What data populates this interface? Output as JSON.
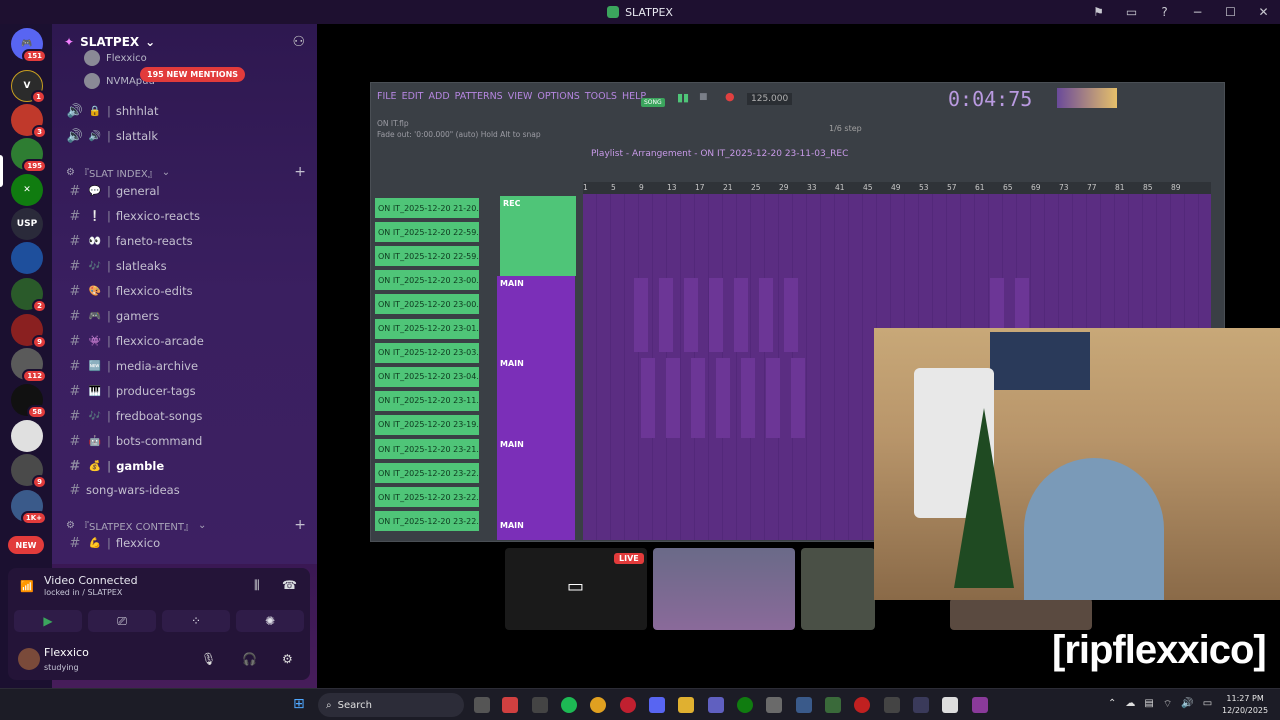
{
  "window": {
    "title": "SLATPEX",
    "controls": [
      "▭",
      "−",
      "☐",
      "✕"
    ]
  },
  "servers": [
    {
      "name": "discord-home",
      "color": "#5865f2",
      "badge": "151"
    },
    {
      "name": "server-v",
      "color": "#2b2b2b",
      "badge": "1"
    },
    {
      "name": "server-3",
      "color": "#c0392b",
      "badge": "3"
    },
    {
      "name": "server-green",
      "color": "#2e7d32",
      "badge": "195"
    },
    {
      "name": "server-xbox",
      "color": "#107c10",
      "badge": ""
    },
    {
      "name": "server-usp",
      "color": "#2a2a3a",
      "badge": ""
    },
    {
      "name": "server-blue",
      "color": "#1e4f9c",
      "badge": ""
    },
    {
      "name": "server-2",
      "color": "#2a5a2a",
      "badge": "2"
    },
    {
      "name": "server-9",
      "color": "#8a2020",
      "badge": "9"
    },
    {
      "name": "server-112",
      "color": "#5a5a5a",
      "badge": "112"
    },
    {
      "name": "server-58",
      "color": "#111111",
      "badge": "58"
    },
    {
      "name": "server-ninja",
      "color": "#e0e0e0",
      "badge": ""
    },
    {
      "name": "server-9b",
      "color": "#4a4a4a",
      "badge": "9"
    },
    {
      "name": "server-1k",
      "color": "#3a5a8a",
      "badge": "1K+"
    },
    {
      "name": "server-new",
      "color": "#222",
      "badge": "NEW"
    }
  ],
  "server_name": "SLATPEX",
  "usp_label": "USP",
  "voice_users": [
    "Flexxico",
    "NVMApuu"
  ],
  "mentions_badge": "195 NEW MENTIONS",
  "voice_channels": [
    {
      "emoji": "🔒",
      "name": "shhhlat"
    },
    {
      "emoji": "🔊",
      "name": "slattalk"
    }
  ],
  "category_index": "『SLAT INDEX』",
  "channels": [
    {
      "emoji": "💬",
      "name": "general",
      "bold": false
    },
    {
      "emoji": "❕",
      "name": "flexxico-reacts",
      "bold": false
    },
    {
      "emoji": "👀",
      "name": "faneto-reacts",
      "bold": false
    },
    {
      "emoji": "🎶",
      "name": "slatleaks",
      "bold": false
    },
    {
      "emoji": "🎨",
      "name": "flexxico-edits",
      "bold": false
    },
    {
      "emoji": "🎮",
      "name": "gamers",
      "bold": false
    },
    {
      "emoji": "👾",
      "name": "flexxico-arcade",
      "bold": false
    },
    {
      "emoji": "🆕",
      "name": "media-archive",
      "bold": false
    },
    {
      "emoji": "🎹",
      "name": "producer-tags",
      "bold": false
    },
    {
      "emoji": "🎶",
      "name": "fredboat-songs",
      "bold": false
    },
    {
      "emoji": "🤖",
      "name": "bots-command",
      "bold": false
    },
    {
      "emoji": "💰",
      "name": "gamble",
      "bold": true
    }
  ],
  "song_wars": "song-wars-ideas",
  "category_content": "『SLATPEX CONTENT』",
  "content_channel": {
    "emoji": "💪",
    "name": "flexxico"
  },
  "voice_panel": {
    "status": "Video Connected",
    "sub": "locked in / SLATPEX",
    "user": "Flexxico",
    "user_status": "studying"
  },
  "fl": {
    "menu": [
      "FILE",
      "EDIT",
      "ADD",
      "PATTERNS",
      "VIEW",
      "OPTIONS",
      "TOOLS",
      "HELP"
    ],
    "song_label": "SONG",
    "bpm": "125.000",
    "time": "0:04:75",
    "file": "ON IT.flp",
    "fade": "Fade out: '0:00.000\" (auto) Hold Alt to snap",
    "step": "1/6 step",
    "playlist_title": "Playlist - Arrangement - ON IT_2025-12-20 23-11-03_REC",
    "ruler": [
      "1",
      "5",
      "9",
      "13",
      "17",
      "21",
      "25",
      "29",
      "33",
      "41",
      "45",
      "49",
      "53",
      "57",
      "61",
      "65",
      "69",
      "73",
      "77",
      "81",
      "85",
      "89"
    ],
    "tracks": [
      "ON IT_2025-12-20 21-20...",
      "ON IT_2025-12-20 22-59...",
      "ON IT_2025-12-20 22-59...",
      "ON IT_2025-12-20 23-00...",
      "ON IT_2025-12-20 23-00...",
      "ON IT_2025-12-20 23-01...",
      "ON IT_2025-12-20 23-03...",
      "ON IT_2025-12-20 23-04...",
      "ON IT_2025-12-20 23-11...",
      "ON IT_2025-12-20 23-19...",
      "ON IT_2025-12-20 23-21...",
      "ON IT_2025-12-20 23-22...",
      "ON IT_2025-12-20 23-22...",
      "ON IT_2025-12-20 23-22..."
    ],
    "blocks": {
      "rec": "REC",
      "main": "MAIN"
    }
  },
  "stream": {
    "live": "LIVE",
    "caption": "[ripflexxico]"
  },
  "taskbar": {
    "search": "Search",
    "time": "11:27 PM",
    "date": "12/20/2025"
  }
}
